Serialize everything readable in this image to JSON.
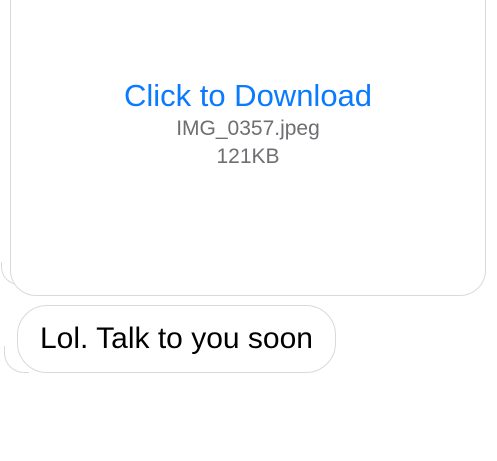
{
  "attachment": {
    "link_label": "Click to Download",
    "file_name": "IMG_0357.jpeg",
    "file_size": "121KB",
    "link_color": "#0a7aff"
  },
  "message": {
    "text": "Lol. Talk to you soon"
  },
  "colors": {
    "bubble_border": "#d9d9de",
    "secondary_text": "#6e6e73",
    "background": "#ffffff"
  }
}
